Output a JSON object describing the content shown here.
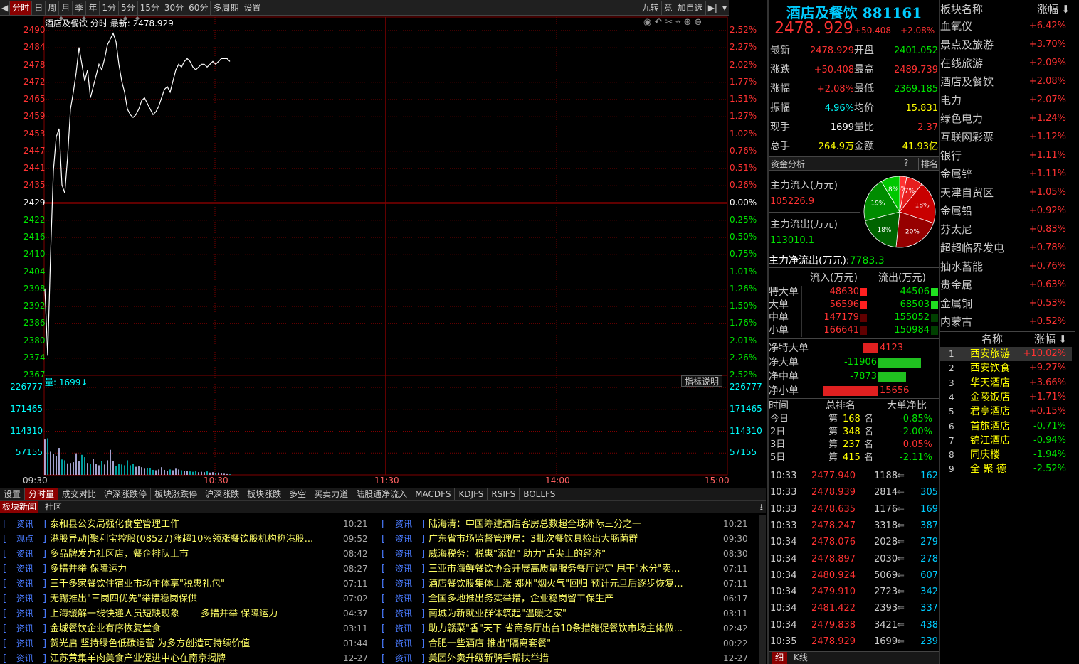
{
  "toolbar": {
    "left_items": [
      "分时",
      "日",
      "周",
      "月",
      "季",
      "年",
      "1分",
      "5分",
      "15分",
      "30分",
      "60分",
      "多周期",
      "设置"
    ],
    "right_items": [
      "九转",
      "竞",
      "加自选"
    ]
  },
  "chart": {
    "legend_name": "酒店及餐饮",
    "legend_mode": "分时",
    "legend_latest_label": "最新:",
    "legend_latest_value": "2478.929",
    "price_labels": [
      "2490",
      "2484",
      "2478",
      "2472",
      "2465",
      "2459",
      "2453",
      "2447",
      "2441",
      "2435",
      "2429",
      "2422",
      "2416",
      "2410",
      "2404",
      "2398",
      "2392",
      "2386",
      "2380",
      "2374",
      "2367"
    ],
    "pct_labels": [
      "2.52%",
      "2.27%",
      "2.02%",
      "1.77%",
      "1.51%",
      "1.27%",
      "1.02%",
      "0.76%",
      "0.51%",
      "0.26%",
      "0.00%",
      "0.25%",
      "0.50%",
      "0.75%",
      "1.01%",
      "1.26%",
      "1.50%",
      "1.76%",
      "2.01%",
      "2.26%",
      "2.52%"
    ],
    "vol_legend_label": "量:",
    "vol_legend_value": "1699↓",
    "indicator_btn": "指标说明",
    "vol_labels": [
      "226777",
      "171465",
      "114310",
      "57155"
    ],
    "time_labels": [
      "09:30",
      "10:30",
      "11:30",
      "14:00",
      "15:00"
    ],
    "colors": {
      "up": "#ff3232",
      "down": "#00e600",
      "grid": "#800000",
      "price_line": "#ffffff"
    }
  },
  "chart_data": {
    "type": "line",
    "title": "",
    "xlabel": "",
    "ylabel": "",
    "ylim": [
      2367,
      2490
    ],
    "base": 2429,
    "x_range": [
      "09:30",
      "15:00"
    ],
    "series": [
      {
        "x": [
          "09:30",
          "09:31",
          "09:32",
          "09:33",
          "09:34",
          "09:35",
          "09:36",
          "09:37",
          "09:38",
          "09:39",
          "09:40",
          "09:41",
          "09:42",
          "09:43",
          "09:44",
          "09:45",
          "09:46",
          "09:47",
          "09:48",
          "09:49",
          "09:50",
          "09:51",
          "09:52",
          "09:53",
          "09:54",
          "09:55",
          "09:56",
          "09:57",
          "09:58",
          "09:59",
          "10:00",
          "10:01",
          "10:02",
          "10:03",
          "10:04",
          "10:05",
          "10:06",
          "10:07",
          "10:08",
          "10:09",
          "10:10",
          "10:11",
          "10:12",
          "10:13",
          "10:14",
          "10:15",
          "10:16",
          "10:17",
          "10:18",
          "10:19",
          "10:20",
          "10:21",
          "10:22",
          "10:23",
          "10:24",
          "10:25",
          "10:26",
          "10:27",
          "10:28",
          "10:29",
          "10:30",
          "10:31",
          "10:32",
          "10:33",
          "10:34",
          "10:35"
        ],
        "values": [
          2398,
          2374,
          2410,
          2440,
          2452,
          2455,
          2435,
          2432,
          2445,
          2462,
          2468,
          2475,
          2484,
          2478,
          2472,
          2476,
          2466,
          2470,
          2474,
          2478,
          2476,
          2480,
          2485,
          2487,
          2489,
          2486,
          2478,
          2472,
          2468,
          2462,
          2460,
          2459,
          2460,
          2462,
          2465,
          2466,
          2464,
          2462,
          2460,
          2461,
          2463,
          2466,
          2469,
          2470,
          2468,
          2472,
          2476,
          2478,
          2477,
          2479,
          2480,
          2479,
          2477,
          2476,
          2477,
          2478,
          2478,
          2477,
          2478,
          2479,
          2478,
          2479,
          2480,
          2480,
          2480,
          2479
        ]
      },
      {
        "name": "量",
        "type": "bar",
        "values": [
          92000,
          95000,
          60000,
          55000,
          48000,
          70000,
          40000,
          38000,
          30000,
          31000,
          33000,
          56000,
          35000,
          52000,
          46000,
          31000,
          28000,
          42000,
          28000,
          25000,
          36000,
          27000,
          38000,
          65000,
          35000,
          23000,
          28000,
          27000,
          25000,
          38000,
          25000,
          28000,
          21000,
          22000,
          20000,
          16000,
          18000,
          18000,
          13000,
          12000,
          14000,
          20000,
          13000,
          11000,
          14000,
          12000,
          16000,
          14000,
          12000,
          10000,
          11000,
          9000,
          8000,
          10000,
          7000,
          8000,
          7000,
          9000,
          6000,
          7000,
          5000,
          6000,
          4000,
          3000,
          2000,
          1699
        ]
      }
    ]
  },
  "bottom_tabs": [
    "设置",
    "分时量",
    "成交对比",
    "沪深涨跌停",
    "板块涨跌停",
    "沪深涨跌",
    "板块涨跌",
    "多空",
    "买卖力道",
    "陆股通净流入",
    "MACDFS",
    "KDJFS",
    "RSIFS",
    "BOLLFS"
  ],
  "news_tabs": [
    "板块新闻",
    "社区"
  ],
  "news_left": [
    {
      "tag": "资讯",
      "title": "泰和县公安局强化食堂管理工作",
      "time": "10:21"
    },
    {
      "tag": "观点",
      "title": "港股异动|聚利宝控股(08527)涨超10%领涨餐饮股机构称港股...",
      "time": "09:52"
    },
    {
      "tag": "资讯",
      "title": "多品牌发力社区店，餐企排队上市",
      "time": "08:42"
    },
    {
      "tag": "资讯",
      "title": "多措并举 保障运力",
      "time": "08:27"
    },
    {
      "tag": "资讯",
      "title": "三千多家餐饮住宿业市场主体享\"税惠礼包\"",
      "time": "07:11"
    },
    {
      "tag": "资讯",
      "title": "无锡推出\"三岗四优先\"举措稳岗保供",
      "time": "07:02"
    },
    {
      "tag": "资讯",
      "title": "上海缓解一线快递人员短缺现象—— 多措并举 保障运力",
      "time": "04:37"
    },
    {
      "tag": "资讯",
      "title": "金城餐饮企业有序恢复堂食",
      "time": "03:11"
    },
    {
      "tag": "资讯",
      "title": "贺光启 坚持绿色低碳运营 为多方创造可持续价值",
      "time": "01:44"
    },
    {
      "tag": "资讯",
      "title": "江苏黄集羊肉美食产业促进中心在南京揭牌",
      "time": "12-27"
    }
  ],
  "news_right": [
    {
      "tag": "资讯",
      "title": "陆海清：中国筹建酒店客房总数超全球洲际三分之一",
      "time": "10:21"
    },
    {
      "tag": "资讯",
      "title": "广东省市场监督管理局：3批次餐饮具检出大肠菌群",
      "time": "09:30"
    },
    {
      "tag": "资讯",
      "title": "威海税务：税惠\"添馅\" 助力\"舌尖上的经济\"",
      "time": "08:30"
    },
    {
      "tag": "资讯",
      "title": "三亚市海鲜餐饮协会开展高质量服务餐厅评定 甩干\"水分\"卖...",
      "time": "07:11"
    },
    {
      "tag": "资讯",
      "title": "酒店餐饮股集体上涨 郑州\"烟火气\"回归 预计元旦后逐步恢复...",
      "time": "07:11"
    },
    {
      "tag": "资讯",
      "title": "全国多地推出务实举措，企业稳岗留工保生产",
      "time": "06:17"
    },
    {
      "tag": "资讯",
      "title": "南城为新就业群体筑起\"温暖之家\"",
      "time": "03:11"
    },
    {
      "tag": "资讯",
      "title": "助力赣菜\"香\"天下 省商务厅出台10条措施促餐饮市场主体做...",
      "time": "02:42"
    },
    {
      "tag": "资讯",
      "title": "合肥一些酒店 推出\"隔离套餐\"",
      "time": "00:22"
    },
    {
      "tag": "资讯",
      "title": "美团外卖升级新骑手帮扶举措",
      "time": "12-27"
    }
  ],
  "quote": {
    "name": "酒店及餐饮",
    "code": "881161",
    "price": "2478.929",
    "change": "+50.408",
    "change_pct": "+2.08%",
    "rows": [
      {
        "l1": "最新",
        "v1": "2478.929",
        "c1": "red",
        "l2": "开盘",
        "v2": "2401.052",
        "c2": "green"
      },
      {
        "l1": "涨跌",
        "v1": "+50.408",
        "c1": "red",
        "l2": "最高",
        "v2": "2489.739",
        "c2": "red"
      },
      {
        "l1": "涨幅",
        "v1": "+2.08%",
        "c1": "red",
        "l2": "最低",
        "v2": "2369.185",
        "c2": "green"
      },
      {
        "l1": "振幅",
        "v1": "4.96%",
        "c1": "cyan",
        "l2": "均价",
        "v2": "15.831",
        "c2": "yellow"
      },
      {
        "l1": "现手",
        "v1": "1699",
        "c1": "white",
        "l2": "量比",
        "v2": "2.37",
        "c2": "red"
      },
      {
        "l1": "总手",
        "v1": "264.9万",
        "c1": "yellow",
        "l2": "金额",
        "v2": "41.93亿",
        "c2": "yellow"
      }
    ]
  },
  "fund": {
    "title": "资金分析",
    "help": "?",
    "rank_btn": "排名",
    "inflow_label": "主力流入(万元)",
    "inflow_value": "105226.9",
    "outflow_label": "主力流出(万元)",
    "outflow_value": "113010.1",
    "net_label": "主力净流出(万元):",
    "net_value": "7783.3",
    "pie": [
      {
        "label": "3%",
        "value": 3,
        "color": "#ff3232"
      },
      {
        "label": "7%",
        "value": 7,
        "color": "#e61e1e"
      },
      {
        "label": "18%",
        "value": 18,
        "color": "#c80000"
      },
      {
        "label": "20%",
        "value": 20,
        "color": "#960000"
      },
      {
        "label": "18%",
        "value": 18,
        "color": "#006400"
      },
      {
        "label": "19%",
        "value": 19,
        "color": "#008c00"
      },
      {
        "label": "8%",
        "value": 8,
        "color": "#00c800"
      }
    ],
    "flow_header_in": "流入(万元)",
    "flow_header_out": "流出(万元)",
    "flow_rows": [
      {
        "label": "特大单",
        "in": "48630",
        "out": "44506"
      },
      {
        "label": "大单",
        "in": "56596",
        "out": "68503"
      },
      {
        "label": "中单",
        "in": "147179",
        "out": "155052"
      },
      {
        "label": "小单",
        "in": "166641",
        "out": "150984"
      }
    ],
    "net_rows": [
      {
        "label": "净特大单",
        "value": "4123",
        "num": 4123
      },
      {
        "label": "净大单",
        "value": "-11906",
        "num": -11906
      },
      {
        "label": "净中单",
        "value": "-7873",
        "num": -7873
      },
      {
        "label": "净小单",
        "value": "15656",
        "num": 15656
      }
    ],
    "rank_header": [
      "时间",
      "总排名",
      "大单净比"
    ],
    "rank_rows": [
      {
        "period": "今日",
        "rank": "168",
        "pct": "-0.85%"
      },
      {
        "period": "2日",
        "rank": "348",
        "pct": "-2.00%"
      },
      {
        "period": "3日",
        "rank": "237",
        "pct": "0.05%"
      },
      {
        "period": "5日",
        "rank": "415",
        "pct": "-2.11%"
      }
    ],
    "rank_prefix": "第",
    "rank_suffix": "名"
  },
  "ticks": [
    {
      "time": "10:33",
      "price": "2477.940",
      "vol": "1188",
      "count": "162"
    },
    {
      "time": "10:33",
      "price": "2478.939",
      "vol": "2814",
      "count": "305"
    },
    {
      "time": "10:33",
      "price": "2478.635",
      "vol": "1176",
      "count": "169"
    },
    {
      "time": "10:33",
      "price": "2478.247",
      "vol": "3318",
      "count": "387"
    },
    {
      "time": "10:34",
      "price": "2478.076",
      "vol": "2028",
      "count": "279"
    },
    {
      "time": "10:34",
      "price": "2478.897",
      "vol": "2030",
      "count": "278"
    },
    {
      "time": "10:34",
      "price": "2480.924",
      "vol": "5069",
      "count": "607"
    },
    {
      "time": "10:34",
      "price": "2479.910",
      "vol": "2723",
      "count": "342"
    },
    {
      "time": "10:34",
      "price": "2481.422",
      "vol": "2393",
      "count": "337"
    },
    {
      "time": "10:34",
      "price": "2479.838",
      "vol": "3421",
      "count": "438"
    },
    {
      "time": "10:35",
      "price": "2478.929",
      "vol": "1699",
      "count": "239"
    }
  ],
  "tick_tabs": [
    "细",
    "K线"
  ],
  "sectors": {
    "header_name": "板块名称",
    "header_pct": "涨幅",
    "items": [
      {
        "name": "血氧仪",
        "pct": "+6.42%"
      },
      {
        "name": "景点及旅游",
        "pct": "+3.70%"
      },
      {
        "name": "在线旅游",
        "pct": "+2.09%"
      },
      {
        "name": "酒店及餐饮",
        "pct": "+2.08%"
      },
      {
        "name": "电力",
        "pct": "+2.07%"
      },
      {
        "name": "绿色电力",
        "pct": "+1.24%"
      },
      {
        "name": "互联网彩票",
        "pct": "+1.12%"
      },
      {
        "name": "银行",
        "pct": "+1.11%"
      },
      {
        "name": "金属锌",
        "pct": "+1.11%"
      },
      {
        "name": "天津自贸区",
        "pct": "+1.05%"
      },
      {
        "name": "金属铅",
        "pct": "+0.92%"
      },
      {
        "name": "芬太尼",
        "pct": "+0.83%"
      },
      {
        "name": "超超临界发电",
        "pct": "+0.78%"
      },
      {
        "name": "抽水蓄能",
        "pct": "+0.76%"
      },
      {
        "name": "贵金属",
        "pct": "+0.63%"
      },
      {
        "name": "金属铜",
        "pct": "+0.53%"
      },
      {
        "name": "内蒙古",
        "pct": "+0.52%"
      }
    ]
  },
  "stocks": {
    "header_name": "名称",
    "header_pct": "涨幅",
    "items": [
      {
        "idx": "1",
        "name": "西安旅游",
        "pct": "+10.02%"
      },
      {
        "idx": "2",
        "name": "西安饮食",
        "pct": "+9.27%"
      },
      {
        "idx": "3",
        "name": "华天酒店",
        "pct": "+3.66%"
      },
      {
        "idx": "4",
        "name": "金陵饭店",
        "pct": "+1.71%"
      },
      {
        "idx": "5",
        "name": "君亭酒店",
        "pct": "+0.15%"
      },
      {
        "idx": "6",
        "name": "首旅酒店",
        "pct": "-0.71%"
      },
      {
        "idx": "7",
        "name": "锦江酒店",
        "pct": "-0.94%"
      },
      {
        "idx": "8",
        "name": "同庆楼",
        "pct": "-1.94%"
      },
      {
        "idx": "9",
        "name": "全 聚 德",
        "pct": "-2.52%"
      }
    ]
  }
}
